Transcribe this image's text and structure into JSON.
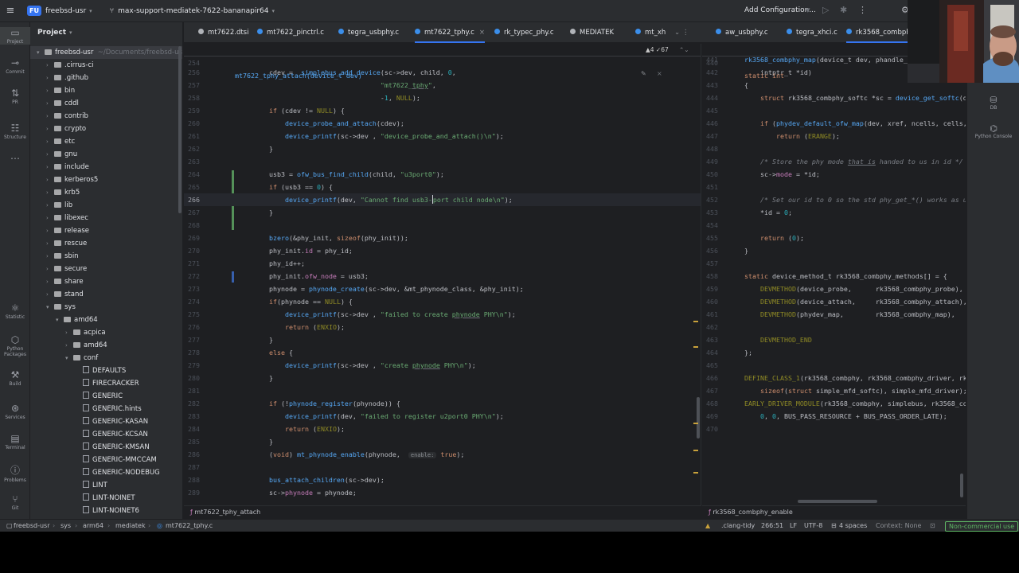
{
  "title_bar": {
    "project_badge": "FU",
    "project_name": "freebsd-usr",
    "branch": "max-support-mediatek-7622-bananapir64",
    "run_config": "Add Configuration..."
  },
  "activity_bar": [
    {
      "label": "Project",
      "icon": "folder-icon"
    },
    {
      "label": "Commit",
      "icon": "commit-icon"
    },
    {
      "label": "PR",
      "icon": "pull-request-icon"
    },
    {
      "label": "Structure",
      "icon": "structure-icon"
    },
    {
      "label": "",
      "icon": "more-icon"
    },
    {
      "label": "Statistic",
      "icon": "statistic-icon"
    },
    {
      "label": "Python Packages",
      "icon": "packages-icon"
    },
    {
      "label": "Build",
      "icon": "hammer-icon"
    },
    {
      "label": "Services",
      "icon": "services-icon"
    },
    {
      "label": "Terminal",
      "icon": "terminal-icon"
    },
    {
      "label": "Problems",
      "icon": "problems-icon"
    },
    {
      "label": "Git",
      "icon": "git-icon"
    }
  ],
  "project_panel": {
    "title": "Project",
    "root": "freebsd-usr",
    "root_path": "~/Documents/freebsd-usr",
    "items": [
      {
        "name": ".cirrus-ci",
        "type": "folder",
        "depth": 1
      },
      {
        "name": ".github",
        "type": "folder",
        "depth": 1
      },
      {
        "name": "bin",
        "type": "folder",
        "depth": 1
      },
      {
        "name": "cddl",
        "type": "folder",
        "depth": 1
      },
      {
        "name": "contrib",
        "type": "folder",
        "depth": 1
      },
      {
        "name": "crypto",
        "type": "folder",
        "depth": 1
      },
      {
        "name": "etc",
        "type": "folder",
        "depth": 1
      },
      {
        "name": "gnu",
        "type": "folder",
        "depth": 1
      },
      {
        "name": "include",
        "type": "folder",
        "depth": 1
      },
      {
        "name": "kerberos5",
        "type": "folder",
        "depth": 1
      },
      {
        "name": "krb5",
        "type": "folder",
        "depth": 1
      },
      {
        "name": "lib",
        "type": "folder",
        "depth": 1
      },
      {
        "name": "libexec",
        "type": "folder",
        "depth": 1
      },
      {
        "name": "release",
        "type": "folder",
        "depth": 1
      },
      {
        "name": "rescue",
        "type": "folder",
        "depth": 1
      },
      {
        "name": "sbin",
        "type": "folder",
        "depth": 1
      },
      {
        "name": "secure",
        "type": "folder",
        "depth": 1
      },
      {
        "name": "share",
        "type": "folder",
        "depth": 1
      },
      {
        "name": "stand",
        "type": "folder",
        "depth": 1
      },
      {
        "name": "sys",
        "type": "folder-open",
        "depth": 1
      },
      {
        "name": "amd64",
        "type": "folder-open",
        "depth": 2
      },
      {
        "name": "acpica",
        "type": "folder",
        "depth": 3
      },
      {
        "name": "amd64",
        "type": "folder",
        "depth": 3
      },
      {
        "name": "conf",
        "type": "folder-open",
        "depth": 3
      },
      {
        "name": "DEFAULTS",
        "type": "file",
        "depth": 4
      },
      {
        "name": "FIRECRACKER",
        "type": "file",
        "depth": 4
      },
      {
        "name": "GENERIC",
        "type": "file",
        "depth": 4
      },
      {
        "name": "GENERIC.hints",
        "type": "file",
        "depth": 4
      },
      {
        "name": "GENERIC-KASAN",
        "type": "file",
        "depth": 4
      },
      {
        "name": "GENERIC-KCSAN",
        "type": "file",
        "depth": 4
      },
      {
        "name": "GENERIC-KMSAN",
        "type": "file",
        "depth": 4
      },
      {
        "name": "GENERIC-MMCCAM",
        "type": "file",
        "depth": 4
      },
      {
        "name": "GENERIC-NODEBUG",
        "type": "file",
        "depth": 4
      },
      {
        "name": "LINT",
        "type": "file",
        "depth": 4
      },
      {
        "name": "LINT-NOINET",
        "type": "file",
        "depth": 4
      },
      {
        "name": "LINT-NOINET6",
        "type": "file",
        "depth": 4
      }
    ]
  },
  "tabs_left": [
    {
      "name": "mt7622.dtsi",
      "color": "#b0b3b8",
      "active": false
    },
    {
      "name": "mt7622_pinctrl.c",
      "color": "#3b8eea",
      "active": false
    },
    {
      "name": "tegra_usbphy.c",
      "color": "#3b8eea",
      "active": false
    },
    {
      "name": "mt7622_tphy.c",
      "color": "#3b8eea",
      "active": true
    },
    {
      "name": "rk_typec_phy.c",
      "color": "#3b8eea",
      "active": false
    },
    {
      "name": "MEDIATEK",
      "color": "#b0b3b8",
      "active": false
    },
    {
      "name": "mt_xh",
      "color": "#3b8eea",
      "active": false
    }
  ],
  "tabs_right": [
    {
      "name": "aw_usbphy.c",
      "color": "#3b8eea",
      "active": false
    },
    {
      "name": "tegra_xhci.c",
      "color": "#3b8eea",
      "active": false
    },
    {
      "name": "rk3568_combphy",
      "color": "#3b8eea",
      "active": true
    }
  ],
  "left_editor": {
    "sticky_line": "254",
    "sticky_code": "mt7622_tphy_attach(device_t dev)",
    "inspection": "▲4 ✓67",
    "lines": [
      {
        "n": "256",
        "html": "cdev =  <span class='fn'>simplebus_add_device</span>(sc->dev, child, <span class='num'>0</span>,"
      },
      {
        "n": "257",
        "html": "                            <span class='str'>\"mt7622_<span class='ul'>tphy</span>\"</span>,"
      },
      {
        "n": "258",
        "html": "                            -<span class='num'>1</span>, <span class='macro'>NULL</span>);"
      },
      {
        "n": "259",
        "html": "<span class='kw'>if</span> (cdev != <span class='macro'>NULL</span>) {"
      },
      {
        "n": "260",
        "html": "    <span class='fn'>device_probe_and_attach</span>(cdev);"
      },
      {
        "n": "261",
        "html": "    <span class='fn'>device_printf</span>(sc->dev , <span class='str'>\"device_probe_and_attach()\\n\"</span>);"
      },
      {
        "n": "262",
        "html": "}"
      },
      {
        "n": "263",
        "html": ""
      },
      {
        "n": "264",
        "html": "usb3 = <span class='fn'>ofw_bus_find_child</span>(child, <span class='str'>\"u3port0\"</span>);"
      },
      {
        "n": "265",
        "html": "<span class='kw'>if</span> (usb3 == <span class='num'>0</span>) {"
      },
      {
        "n": "266",
        "html": "    <span class='fn'>device_printf</span>(dev, <span class='str'>\"Cannot find usb3-<span class='caret'></span>port child node\\n\"</span>);",
        "caret": true
      },
      {
        "n": "267",
        "html": "}"
      },
      {
        "n": "268",
        "html": ""
      },
      {
        "n": "269",
        "html": "<span class='fn'>bzero</span>(&phy_init, <span class='kw'>sizeof</span>(phy_init));"
      },
      {
        "n": "270",
        "html": "phy_init.<span class='fld'>id</span> = phy_id;"
      },
      {
        "n": "271",
        "html": "phy_id++;"
      },
      {
        "n": "272",
        "html": "phy_init.<span class='fld'>ofw_node</span> = usb3;"
      },
      {
        "n": "273",
        "html": "phynode = <span class='fn'>phynode_create</span>(sc->dev, &mt_phynode_class, &phy_init);"
      },
      {
        "n": "274",
        "html": "<span class='kw'>if</span>(phynode == <span class='macro'>NULL</span>) {"
      },
      {
        "n": "275",
        "html": "    <span class='fn'>device_printf</span>(sc->dev , <span class='str'>\"failed to create <span class='ul'>phynode</span> PHY\\n\"</span>);"
      },
      {
        "n": "276",
        "html": "    <span class='kw'>return</span> (<span class='macro'>ENXIO</span>);"
      },
      {
        "n": "277",
        "html": "}"
      },
      {
        "n": "278",
        "html": "<span class='kw'>else</span> {"
      },
      {
        "n": "279",
        "html": "    <span class='fn'>device_printf</span>(sc->dev , <span class='str'>\"create <span class='ul'>phynode</span> PHY\\n\"</span>);"
      },
      {
        "n": "280",
        "html": "}"
      },
      {
        "n": "281",
        "html": ""
      },
      {
        "n": "282",
        "html": "<span class='kw'>if</span> (!<span class='fn'>phynode_register</span>(phynode)) {"
      },
      {
        "n": "283",
        "html": "    <span class='fn'>device_printf</span>(dev, <span class='str'>\"failed to register u2port0 PHY\\n\"</span>);"
      },
      {
        "n": "284",
        "html": "    <span class='kw'>return</span> (<span class='macro'>ENXIO</span>);"
      },
      {
        "n": "285",
        "html": "}"
      },
      {
        "n": "286",
        "html": "(<span class='kw'>void</span>) <span class='fn'>mt_phynode_enable</span>(phynode,  <span class='hint'>enable:</span> <span class='kw'>true</span>);"
      },
      {
        "n": "287",
        "html": ""
      },
      {
        "n": "288",
        "html": "<span class='fn'>bus_attach_children</span>(sc->dev);"
      },
      {
        "n": "289",
        "html": "sc-><span class='fld'>phynode</span> = phynode;"
      }
    ]
  },
  "right_editor": {
    "sticky_line": "440",
    "sticky_code": "<span class='kw'>static int</span>",
    "lines": [
      {
        "n": "441",
        "html": "<span class='fn'>rk3568_combphy_map</span>(device_t dev, phandle_t xref, int ncells,"
      },
      {
        "n": "442",
        "html": "    intptr_t *id)"
      },
      {
        "n": "443",
        "html": "{"
      },
      {
        "n": "444",
        "html": "    <span class='kw'>struct</span> rk3568_combphy_softc *sc = <span class='fn'>device_get_softc</span>(dev);"
      },
      {
        "n": "445",
        "html": ""
      },
      {
        "n": "446",
        "html": "    <span class='kw'>if</span> (<span class='fn'>phydev_default_ofw_map</span>(dev, xref, ncells, cells, id))"
      },
      {
        "n": "447",
        "html": "        <span class='kw'>return</span> (<span class='macro'>ERANGE</span>);"
      },
      {
        "n": "448",
        "html": ""
      },
      {
        "n": "449",
        "html": "    <span class='cm'>/* Store the phy mode <span class='ul'>that is</span> handed to us in id */</span>"
      },
      {
        "n": "450",
        "html": "    sc-><span class='fld'>mode</span> = *id;"
      },
      {
        "n": "451",
        "html": ""
      },
      {
        "n": "452",
        "html": "    <span class='cm'>/* Set our id to 0 so the std phy_get_*() works as usual */</span>"
      },
      {
        "n": "453",
        "html": "    *id = <span class='num'>0</span>;"
      },
      {
        "n": "454",
        "html": ""
      },
      {
        "n": "455",
        "html": "    <span class='kw'>return</span> (<span class='num'>0</span>);"
      },
      {
        "n": "456",
        "html": "}"
      },
      {
        "n": "457",
        "html": ""
      },
      {
        "n": "458",
        "html": "<span class='kw'>static</span> device_method_t rk3568_combphy_methods[] = {"
      },
      {
        "n": "459",
        "html": "    <span class='macro'>DEVMETHOD</span>(device_probe,      rk3568_combphy_probe),"
      },
      {
        "n": "460",
        "html": "    <span class='macro'>DEVMETHOD</span>(device_attach,     rk3568_combphy_attach),"
      },
      {
        "n": "461",
        "html": "    <span class='macro'>DEVMETHOD</span>(phydev_map,        rk3568_combphy_map),"
      },
      {
        "n": "462",
        "html": ""
      },
      {
        "n": "463",
        "html": "    <span class='macro'>DEVMETHOD_END</span>"
      },
      {
        "n": "464",
        "html": "};"
      },
      {
        "n": "465",
        "html": ""
      },
      {
        "n": "466",
        "html": "<span class='macro'>DEFINE_CLASS_1</span>(rk3568_combphy, rk3568_combphy_driver, rk3568_combphy_methods,"
      },
      {
        "n": "467",
        "html": "    <span class='kw'>sizeof</span>(<span class='kw'>struct</span> simple_mfd_softc), simple_mfd_driver);"
      },
      {
        "n": "468",
        "html": "<span class='macro'>EARLY_DRIVER_MODULE</span>(rk3568_combphy, simplebus, rk3568_combphy_driver,"
      },
      {
        "n": "469",
        "html": "    <span class='num'>0</span>, <span class='num'>0</span>, BUS_PASS_RESOURCE + BUS_PASS_ORDER_LATE);"
      },
      {
        "n": "470",
        "html": ""
      }
    ]
  },
  "crumbs": {
    "left": "mt7622_tphy_attach",
    "right": "rk3568_combphy_enable"
  },
  "right_tools": [
    {
      "label": "DB",
      "icon": "database-icon"
    },
    {
      "label": "Python Console",
      "icon": "python-console-icon"
    }
  ],
  "status_bar": {
    "path": [
      "freebsd-usr",
      "sys",
      "arm64",
      "mediatek",
      "mt7622_tphy.c"
    ],
    "clang_tidy": ".clang-tidy",
    "position": "266:51",
    "line_ending": "LF",
    "encoding": "UTF-8",
    "indent": "4 spaces",
    "context": "Context: None",
    "license": "Non-commercial use"
  },
  "colors": {
    "accent": "#3574f0",
    "editor_bg": "#1e1f22",
    "panel_bg": "#2b2d30"
  }
}
